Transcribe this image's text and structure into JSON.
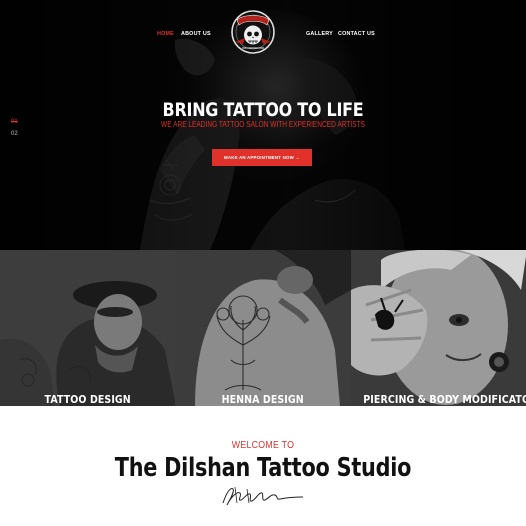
{
  "nav": {
    "left_items": [
      {
        "label": "HOME",
        "active": true
      },
      {
        "label": "ABOUT US",
        "active": false
      }
    ],
    "right_items": [
      {
        "label": "GALLERY",
        "active": false
      },
      {
        "label": "CONTACT US",
        "active": false
      }
    ],
    "logo_icon": "skull-banner-logo-icon"
  },
  "hero": {
    "title": "BRING TATTOO TO LIFE",
    "subtitle": "WE ARE LEADING TATTOO SALON WITH EXPERIENCED ARTISTS",
    "cta_label": "MAKE AN APPOINTMENT NOW →",
    "slides": [
      {
        "label": "01",
        "active": true
      },
      {
        "label": "02",
        "active": false
      }
    ]
  },
  "services": [
    {
      "label": "TATTOO DESIGN"
    },
    {
      "label": "HENNA DESIGN"
    },
    {
      "label": "PIERCING & BODY MODIFICATON"
    }
  ],
  "welcome": {
    "kicker": "WELCOME TO",
    "title": "The Dilshan Tattoo Studio"
  },
  "colors": {
    "accent": "#e0312a",
    "dark": "#050505",
    "text_dark": "#111111"
  }
}
